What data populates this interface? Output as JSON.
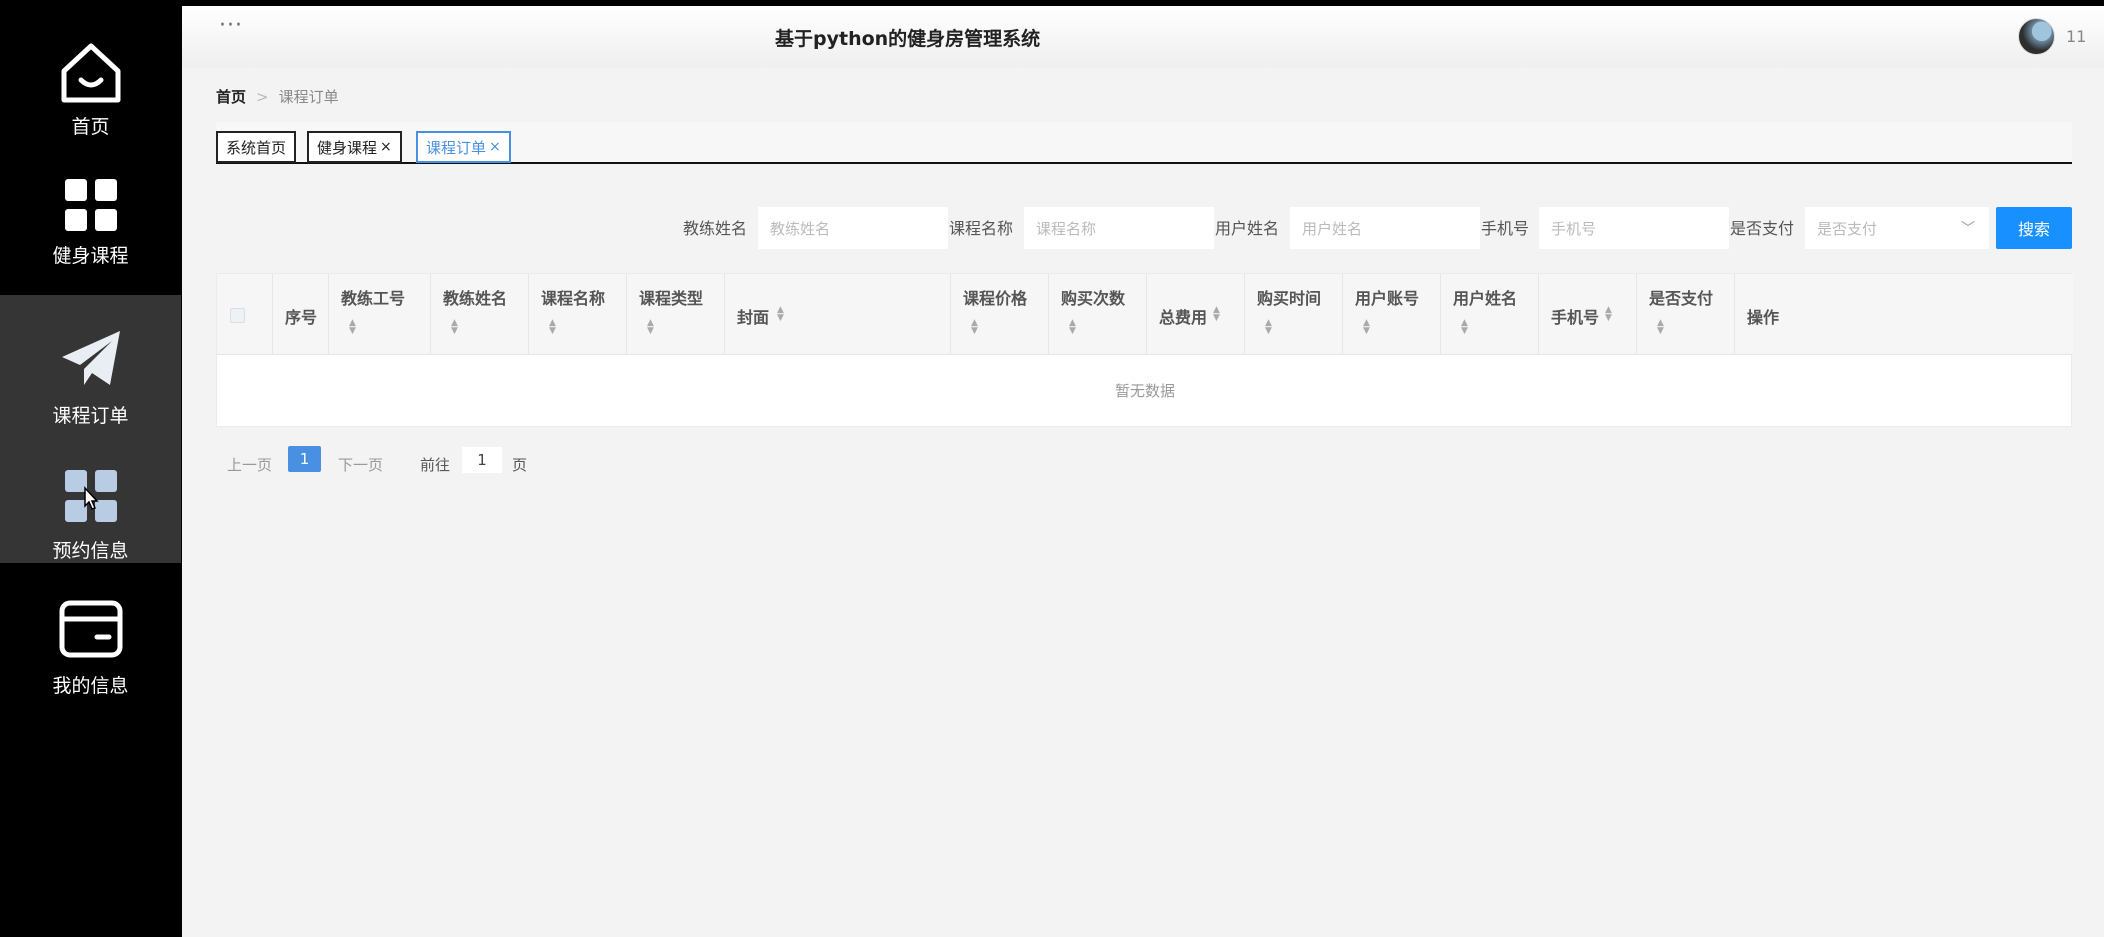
{
  "sidebar": {
    "items": [
      {
        "label": "首页",
        "icon": "home-icon"
      },
      {
        "label": "健身课程",
        "icon": "grid-icon"
      },
      {
        "label": "课程订单",
        "icon": "paper-plane-icon"
      },
      {
        "label": "预约信息",
        "icon": "grid-icon"
      },
      {
        "label": "我的信息",
        "icon": "card-icon"
      }
    ]
  },
  "header": {
    "menu_glyph": "···",
    "title": "基于python的健身房管理系统",
    "username": "11"
  },
  "breadcrumb": {
    "home": "首页",
    "separator": ">",
    "current": "课程订单"
  },
  "tabs": [
    {
      "label": "系统首页",
      "closable": false
    },
    {
      "label": "健身课程",
      "closable": true
    },
    {
      "label": "课程订单",
      "closable": true,
      "active": true
    }
  ],
  "tab_close_glyph": "×",
  "search": {
    "coach_name_label": "教练姓名",
    "coach_name_placeholder": "教练姓名",
    "course_name_label": "课程名称",
    "course_name_placeholder": "课程名称",
    "user_name_label": "用户姓名",
    "user_name_placeholder": "用户姓名",
    "phone_label": "手机号",
    "phone_placeholder": "手机号",
    "paid_label": "是否支付",
    "paid_placeholder": "是否支付",
    "button": "搜索"
  },
  "table": {
    "columns": [
      "序号",
      "教练工号",
      "教练姓名",
      "课程名称",
      "课程类型",
      "封面",
      "课程价格",
      "购买次数",
      "总费用",
      "购买时间",
      "用户账号",
      "用户姓名",
      "手机号",
      "是否支付",
      "操作"
    ],
    "empty_text": "暂无数据"
  },
  "pagination": {
    "prev": "上一页",
    "current_page": "1",
    "next": "下一页",
    "goto_label": "前往",
    "goto_value": "1",
    "page_unit": "页"
  }
}
